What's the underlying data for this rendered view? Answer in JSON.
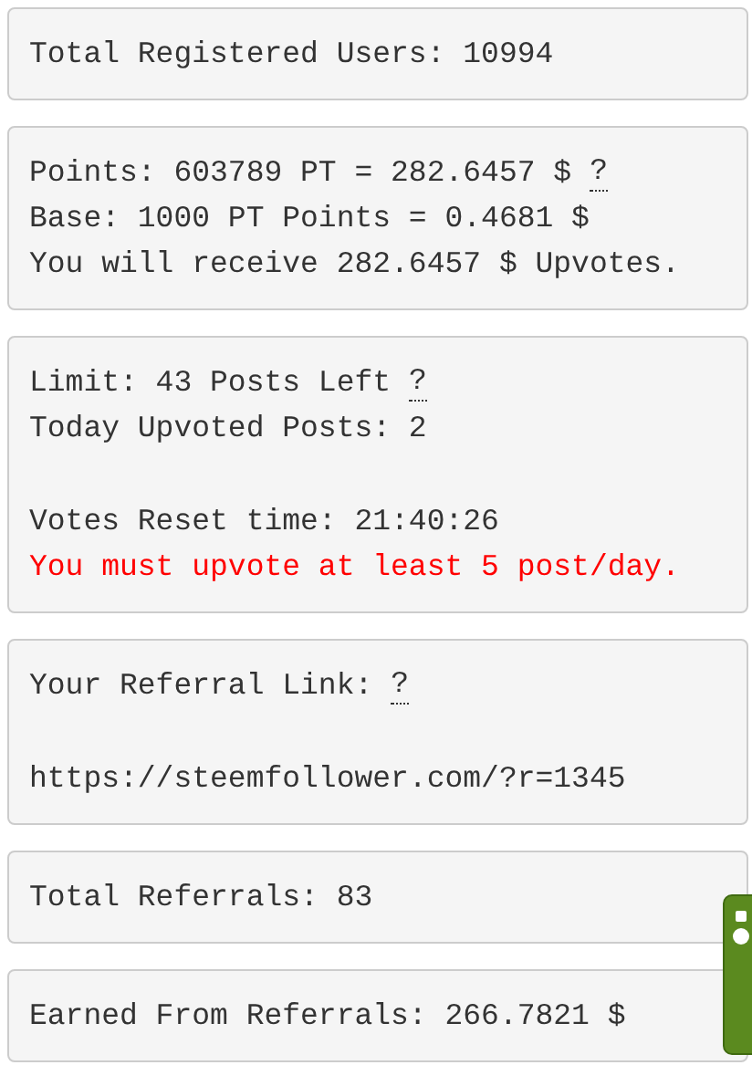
{
  "panels": [
    {
      "groups": [
        [
          {
            "kind": "plain",
            "text": "Total Registered Users: 10994"
          }
        ]
      ]
    },
    {
      "groups": [
        [
          {
            "kind": "plain",
            "text": "Points: 603789 PT = 282.6457 $",
            "help": "?"
          },
          {
            "kind": "plain",
            "text": "Base: 1000 PT Points = 0.4681 $"
          },
          {
            "kind": "plain",
            "text": "You will receive 282.6457 $ Upvotes."
          }
        ]
      ]
    },
    {
      "groups": [
        [
          {
            "kind": "plain",
            "text": "Limit: 43 Posts Left",
            "help": "?"
          },
          {
            "kind": "plain",
            "text": "Today Upvoted Posts: 2"
          }
        ],
        [
          {
            "kind": "plain",
            "text": "Votes Reset time: 21:40:26"
          },
          {
            "kind": "warning",
            "text": "You must upvote at least 5 post/day.",
            "color": "#ff0000"
          }
        ]
      ]
    },
    {
      "groups": [
        [
          {
            "kind": "plain",
            "text": "Your Referral Link:",
            "help": "?"
          }
        ],
        [
          {
            "kind": "plain",
            "text": "https://steemfollower.com/?r=1345"
          }
        ]
      ]
    },
    {
      "groups": [
        [
          {
            "kind": "plain",
            "text": "Total Referrals: 83"
          }
        ]
      ]
    },
    {
      "groups": [
        [
          {
            "kind": "plain",
            "text": "Earned From Referrals: 266.7821 $"
          }
        ]
      ]
    }
  ],
  "side_tab": {
    "kind": "feedback"
  }
}
